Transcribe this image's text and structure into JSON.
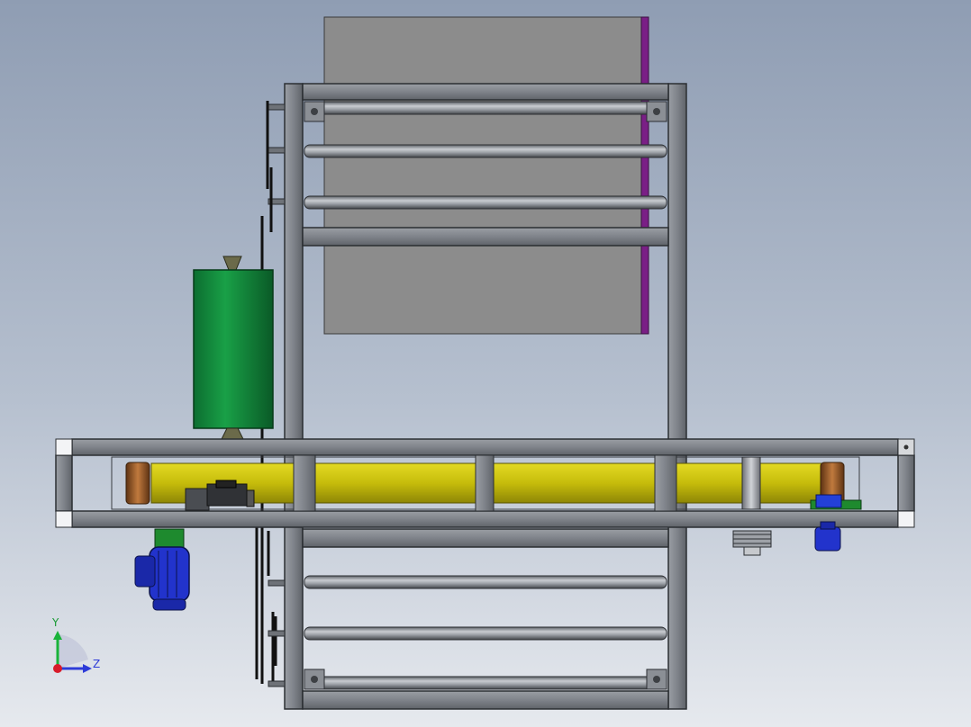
{
  "viewport": {
    "background_top": "#8e9db3",
    "background_bottom": "#e4e8ee",
    "description_colors": {
      "frame_steel": "#7b7f86",
      "frame_edge": "#2f3236",
      "panel": "#8e8e8e",
      "purple_edge": "#7a1f86",
      "green_tank": "#0f8a3c",
      "yellow_belt": "#c9c10a",
      "roller_brown": "#9a5a2a",
      "motor_blue": "#2233cc",
      "motor_green": "#1e8a2e"
    }
  },
  "axis_triad": {
    "y_label": "Y",
    "z_label": "Z",
    "y_color": "#19b33a",
    "z_color": "#2d3bd8",
    "origin_color": "#d81b2a"
  }
}
